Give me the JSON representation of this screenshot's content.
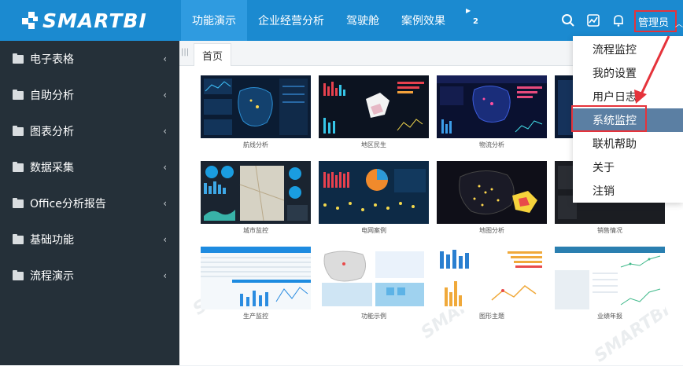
{
  "logo": {
    "text": "SMARTBI"
  },
  "nav": {
    "tabs": [
      {
        "label": "功能演示",
        "active": true
      },
      {
        "label": "企业经营分析",
        "active": false
      },
      {
        "label": "驾驶舱",
        "active": false
      },
      {
        "label": "案例效果",
        "active": false
      }
    ],
    "more_badge": "2"
  },
  "top_icons": [
    "search-icon",
    "chart-icon",
    "bell-icon"
  ],
  "user": {
    "label": "管理员"
  },
  "sidebar": {
    "items": [
      {
        "label": "电子表格"
      },
      {
        "label": "自助分析"
      },
      {
        "label": "图表分析"
      },
      {
        "label": "数据采集"
      },
      {
        "label": "Office分析报告"
      },
      {
        "label": "基础功能"
      },
      {
        "label": "流程演示"
      }
    ]
  },
  "tabbar": {
    "home": "首页"
  },
  "thumbnails": [
    {
      "label": "航线分析"
    },
    {
      "label": "地区民生"
    },
    {
      "label": "物流分析"
    },
    {
      "label": ""
    },
    {
      "label": "城市监控"
    },
    {
      "label": "电网案例"
    },
    {
      "label": "地图分析"
    },
    {
      "label": "销售情况"
    },
    {
      "label": "生产监控"
    },
    {
      "label": "功能示例"
    },
    {
      "label": "图形主题"
    },
    {
      "label": "业绩年报"
    }
  ],
  "dropdown": {
    "items": [
      {
        "label": "流程监控",
        "active": false
      },
      {
        "label": "我的设置",
        "active": false
      },
      {
        "label": "用户日志",
        "active": false
      },
      {
        "label": "系统监控",
        "active": true
      },
      {
        "label": "联机帮助",
        "active": false
      },
      {
        "label": "关于",
        "active": false
      },
      {
        "label": "注销",
        "active": false
      }
    ]
  },
  "colors": {
    "topbar": "#1b8ad0",
    "sidebar": "#253039",
    "highlight": "#e5333b",
    "menu_active": "#5b7fa3"
  }
}
